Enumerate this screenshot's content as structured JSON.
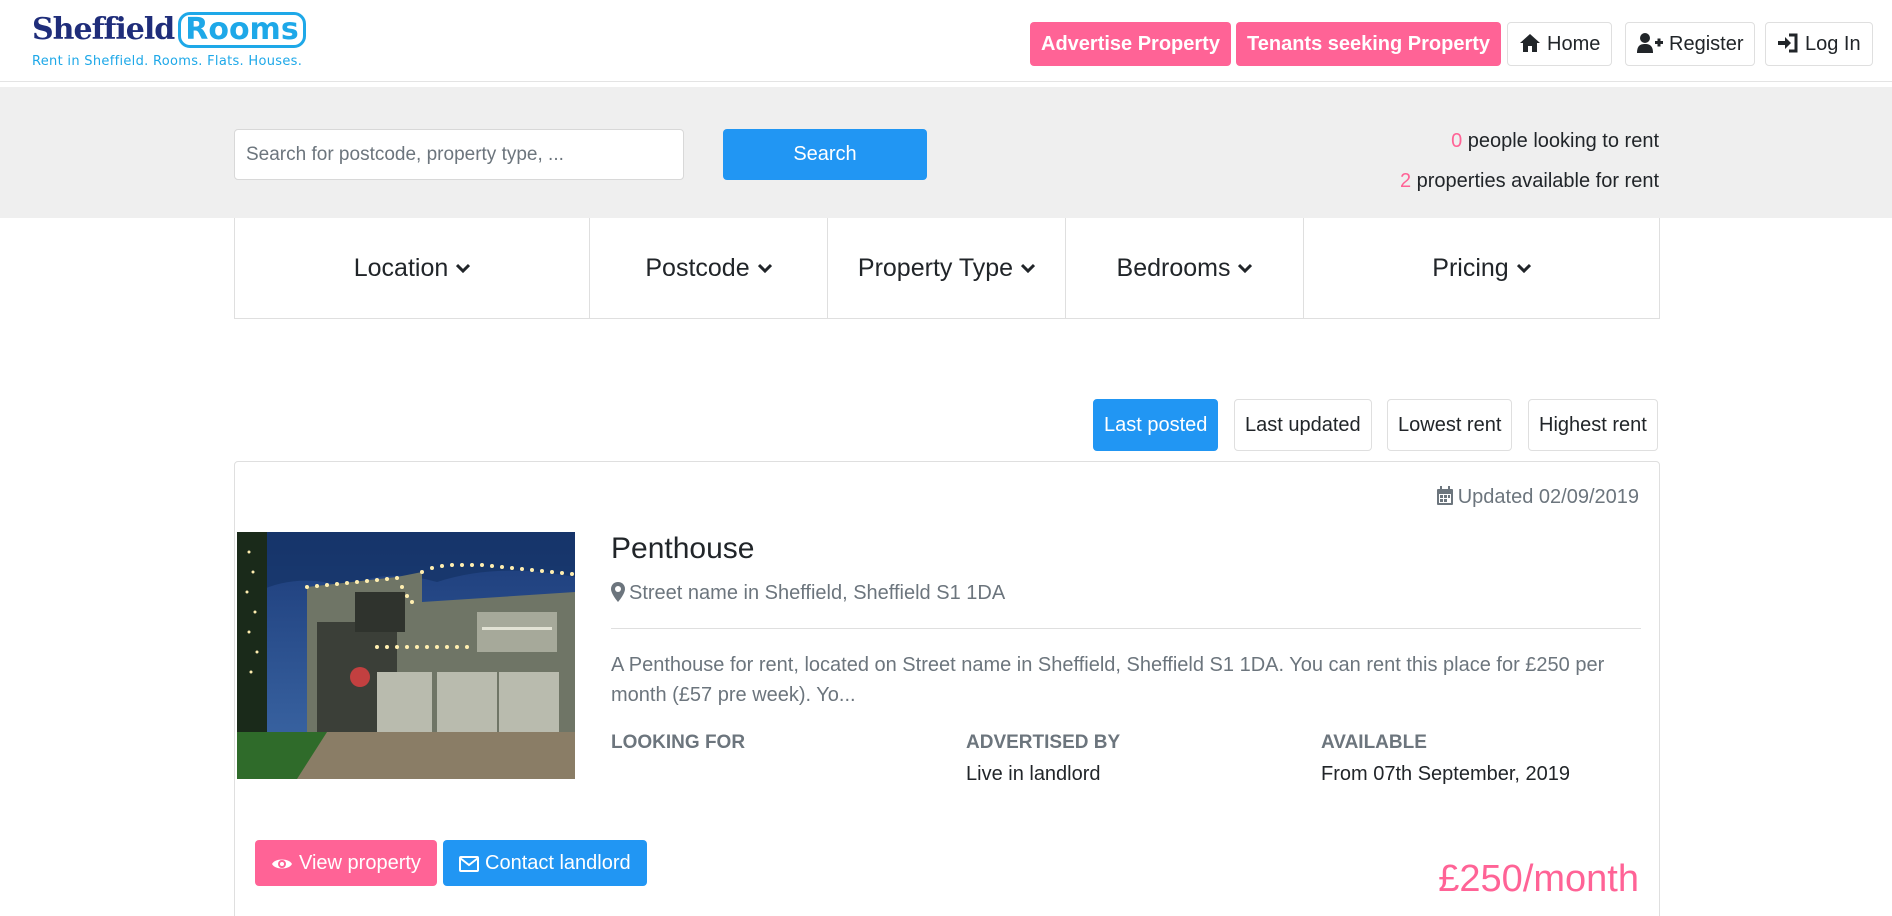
{
  "brand": {
    "name_part1": "Sheffield",
    "name_part2": "Rooms",
    "tagline": "Rent in Sheffield. Rooms. Flats. Houses."
  },
  "nav": {
    "advertise": "Advertise Property",
    "tenants": "Tenants seeking Property",
    "home": "Home",
    "register": "Register",
    "login": "Log In"
  },
  "search": {
    "placeholder": "Search for postcode, property type, ...",
    "button": "Search"
  },
  "stats": {
    "people_count": "0",
    "people_text": "people looking to rent",
    "properties_count": "2",
    "properties_text": "properties available for rent"
  },
  "filters": [
    "Location",
    "Postcode",
    "Property Type",
    "Bedrooms",
    "Pricing"
  ],
  "sort": {
    "last_posted": "Last posted",
    "last_updated": "Last updated",
    "lowest_rent": "Lowest rent",
    "highest_rent": "Highest rent",
    "active": "last_posted"
  },
  "listing": {
    "updated": "Updated 02/09/2019",
    "title": "Penthouse",
    "address": "Street name in Sheffield, Sheffield S1 1DA",
    "description": "A Penthouse for rent, located on Street name in Sheffield, Sheffield S1 1DA. You can rent this place for £250 per month (£57 pre week). Yo...",
    "looking_for_label": "LOOKING FOR",
    "looking_for_value": "",
    "advertised_by_label": "ADVERTISED BY",
    "advertised_by_value": "Live in landlord",
    "available_label": "AVAILABLE",
    "available_value": "From 07th September, 2019",
    "view_button": "View property",
    "contact_button": "Contact landlord",
    "price": "£250/month"
  },
  "colors": {
    "pink": "#ff6396",
    "blue": "#2196f3",
    "navy": "#1f2d7a",
    "cyan": "#1ea8e8"
  },
  "icons": {
    "home": "home-icon",
    "register": "user-plus-icon",
    "login": "sign-in-icon",
    "filter": "chevron-down-icon",
    "updated": "calendar-icon",
    "address": "map-marker-icon",
    "view": "eye-icon",
    "contact": "envelope-icon"
  }
}
